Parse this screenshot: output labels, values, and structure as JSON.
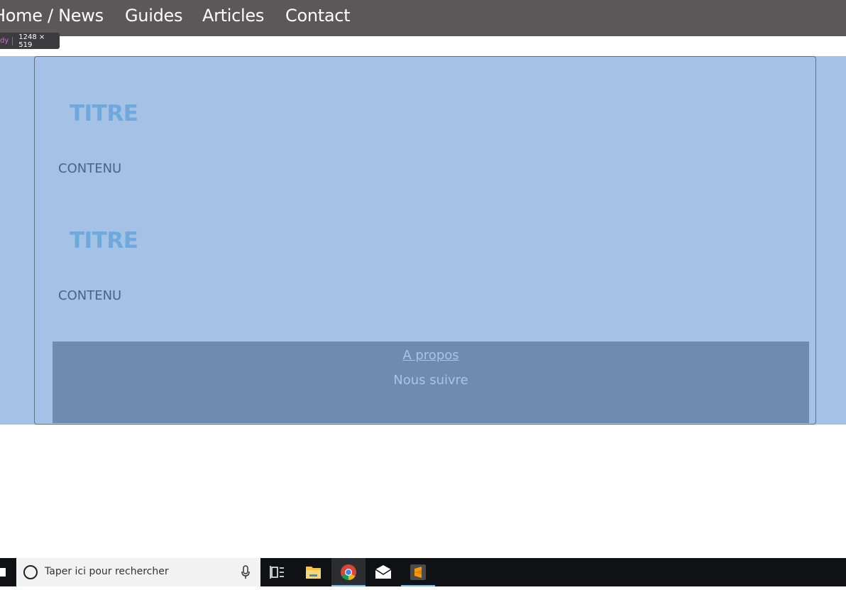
{
  "nav": {
    "items": [
      "Home / News",
      "Guides",
      "Articles",
      "Contact"
    ]
  },
  "devtools": {
    "tag": "dy",
    "size": "1248 × 519"
  },
  "main": {
    "sections": [
      {
        "title": "TITRE",
        "content": "CONTENU"
      },
      {
        "title": "TITRE",
        "content": "CONTENU"
      }
    ]
  },
  "footer": {
    "link": "A propos",
    "text": "Nous suivre"
  },
  "taskbar": {
    "search_placeholder": "Taper ici pour rechercher",
    "icons": [
      "task-view-icon",
      "file-explorer-icon",
      "chrome-icon",
      "mail-icon",
      "sublime-text-icon"
    ]
  },
  "colors": {
    "nav_bg": "#5a5859",
    "body_highlight": "#a3c2e6",
    "title": "#6fa8dc",
    "footer_bg": "#6e8caf",
    "taskbar_bg": "#101114"
  }
}
